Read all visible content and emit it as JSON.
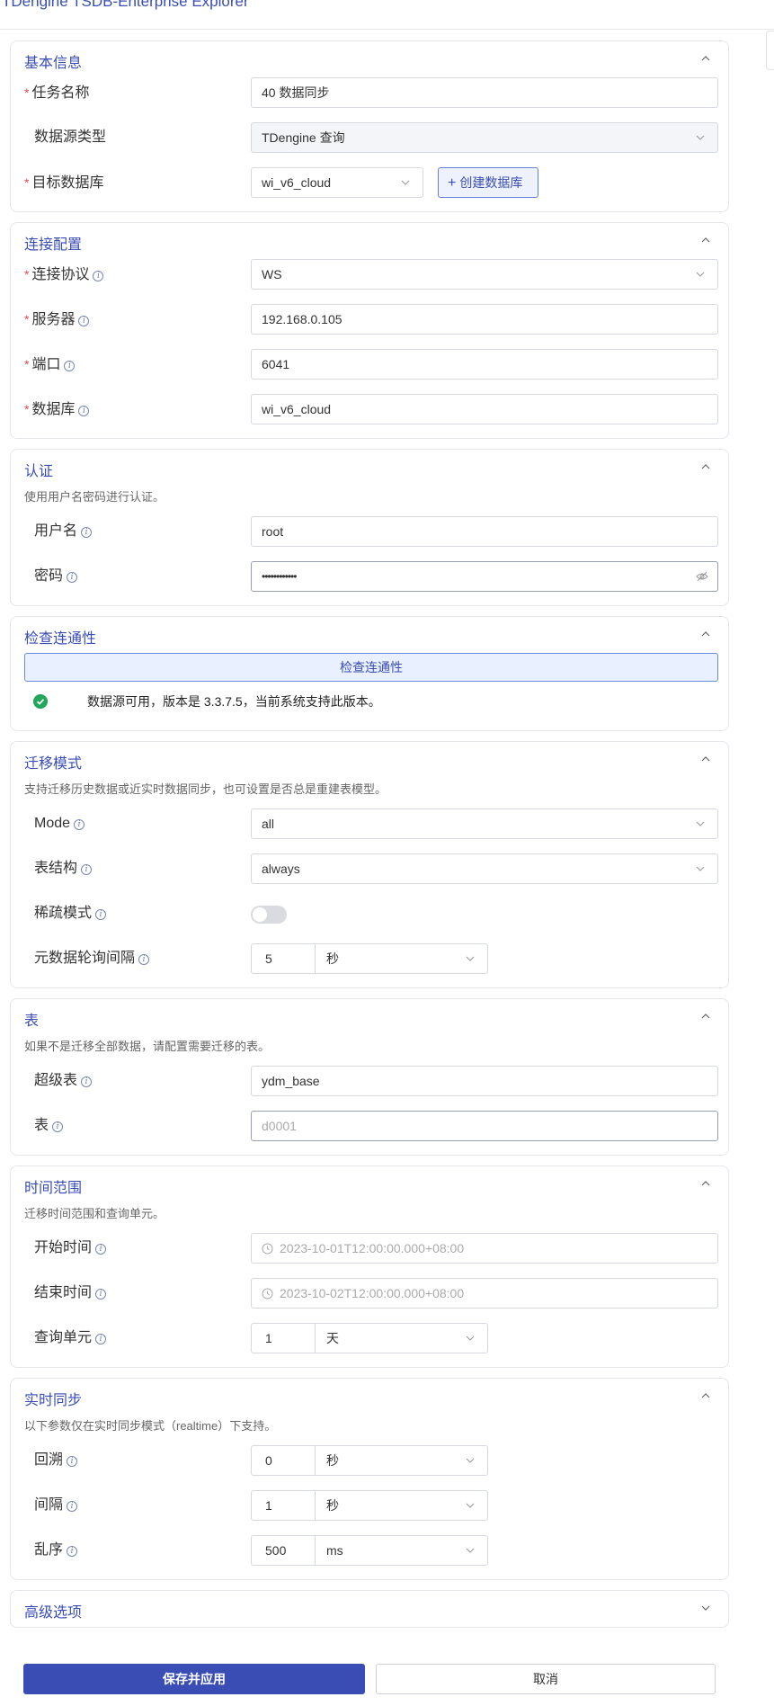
{
  "app": {
    "title": "TDengine TSDB-Enterprise Explorer"
  },
  "colors": {
    "accent": "#3a4db4",
    "required": "#e5484d",
    "success": "#21a65b"
  },
  "basic": {
    "title": "基本信息",
    "task_name_label": "任务名称",
    "task_name_value": "40 数据同步",
    "source_type_label": "数据源类型",
    "source_type_value": "TDengine 查询",
    "target_db_label": "目标数据库",
    "target_db_value": "wi_v6_cloud",
    "create_db_button": "创建数据库"
  },
  "connection": {
    "title": "连接配置",
    "protocol_label": "连接协议",
    "protocol_value": "WS",
    "server_label": "服务器",
    "server_value": "192.168.0.105",
    "port_label": "端口",
    "port_value": "6041",
    "database_label": "数据库",
    "database_value": "wi_v6_cloud"
  },
  "auth": {
    "title": "认证",
    "desc": "使用用户名密码进行认证。",
    "username_label": "用户名",
    "username_value": "root",
    "password_label": "密码",
    "password_value": "••••••••••••"
  },
  "connectivity": {
    "title": "检查连通性",
    "check_button": "检查连通性",
    "result_text": "数据源可用，版本是 3.3.7.5，当前系统支持此版本。"
  },
  "migration": {
    "title": "迁移模式",
    "desc": "支持迁移历史数据或近实时数据同步，也可设置是否总是重建表模型。",
    "mode_label": "Mode",
    "mode_value": "all",
    "schema_label": "表结构",
    "schema_value": "always",
    "sparse_label": "稀疏模式",
    "sparse_enabled": false,
    "meta_interval_label": "元数据轮询间隔",
    "meta_interval_value": "5",
    "meta_interval_unit": "秒"
  },
  "tables": {
    "title": "表",
    "desc": "如果不是迁移全部数据，请配置需要迁移的表。",
    "stable_label": "超级表",
    "stable_value": "ydm_base",
    "table_label": "表",
    "table_placeholder": "d0001"
  },
  "time_range": {
    "title": "时间范围",
    "desc": "迁移时间范围和查询单元。",
    "start_label": "开始时间",
    "start_placeholder": "2023-10-01T12:00:00.000+08:00",
    "end_label": "结束时间",
    "end_placeholder": "2023-10-02T12:00:00.000+08:00",
    "unit_label": "查询单元",
    "unit_value": "1",
    "unit_unit": "天"
  },
  "realtime": {
    "title": "实时同步",
    "desc": "以下参数仅在实时同步模式（realtime）下支持。",
    "lookback_label": "回溯",
    "lookback_value": "0",
    "lookback_unit": "秒",
    "interval_label": "间隔",
    "interval_value": "1",
    "interval_unit": "秒",
    "disorder_label": "乱序",
    "disorder_value": "500",
    "disorder_unit": "ms"
  },
  "advanced": {
    "title": "高级选项"
  },
  "actions": {
    "save": "保存并应用",
    "cancel": "取消"
  }
}
